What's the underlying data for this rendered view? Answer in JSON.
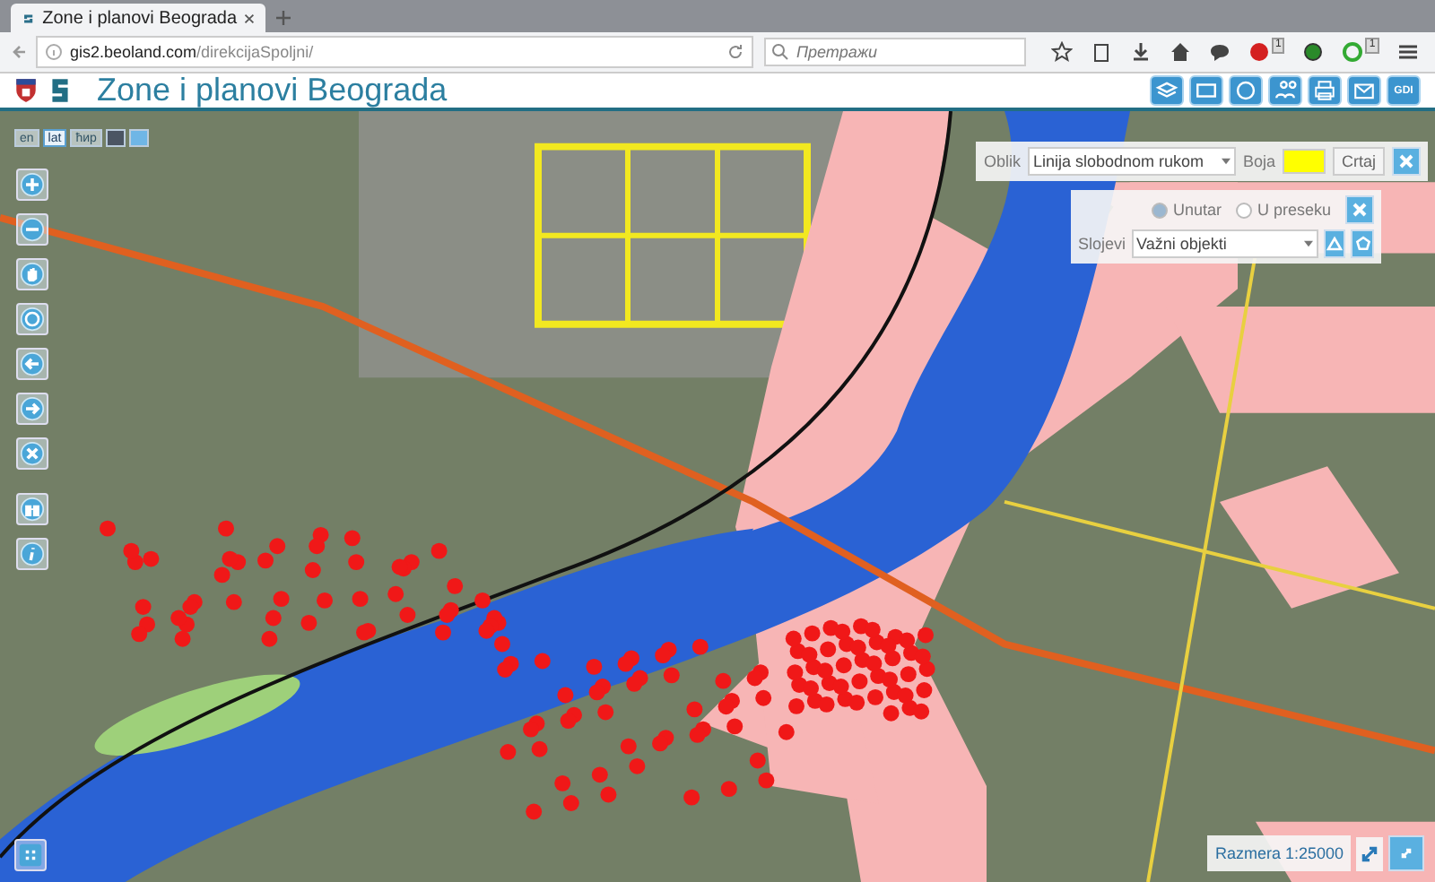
{
  "browser": {
    "tab_title": "Zone i planovi Beograda",
    "url_host": "gis2.beoland.com",
    "url_path": "/direkcijaSpoljni/",
    "search_placeholder": "Претражи",
    "toolbar": [
      {
        "kind": "star"
      },
      {
        "kind": "clipboard"
      },
      {
        "kind": "download"
      },
      {
        "kind": "home"
      },
      {
        "kind": "chat"
      },
      {
        "kind": "adblock",
        "badge": "1"
      },
      {
        "kind": "dot"
      },
      {
        "kind": "ext",
        "badge": "1"
      },
      {
        "kind": "menu"
      }
    ]
  },
  "header": {
    "title": "Zone i planovi Beograda",
    "buttons": [
      {
        "kind": "layers"
      },
      {
        "kind": "map"
      },
      {
        "kind": "globe"
      },
      {
        "kind": "people"
      },
      {
        "kind": "print"
      },
      {
        "kind": "mail"
      },
      {
        "kind": "text",
        "label": "GDI"
      }
    ]
  },
  "languages": [
    {
      "label": "en",
      "selected": false
    },
    {
      "label": "lat",
      "selected": true
    },
    {
      "label": "ћир",
      "selected": false
    }
  ],
  "map_tools": [
    {
      "kind": "plus"
    },
    {
      "kind": "minus"
    },
    {
      "kind": "hand"
    },
    {
      "kind": "globe"
    },
    {
      "kind": "back"
    },
    {
      "kind": "forward"
    },
    {
      "kind": "clear"
    },
    {
      "kind": "binoculars"
    },
    {
      "kind": "info"
    }
  ],
  "draw_panel": {
    "shape_label": "Oblik",
    "shape_value": "Linija slobodnom rukom",
    "color_label": "Boja",
    "color": "#ffff00",
    "draw_button": "Crtaj"
  },
  "select_panel": {
    "radios": [
      {
        "label": "Unutar",
        "selected": true
      },
      {
        "label": "U preseku",
        "selected": false
      }
    ],
    "layers_label": "Slojevi",
    "layers_value": "Važni objekti"
  },
  "scale": {
    "label": "Razmera 1:25000"
  }
}
